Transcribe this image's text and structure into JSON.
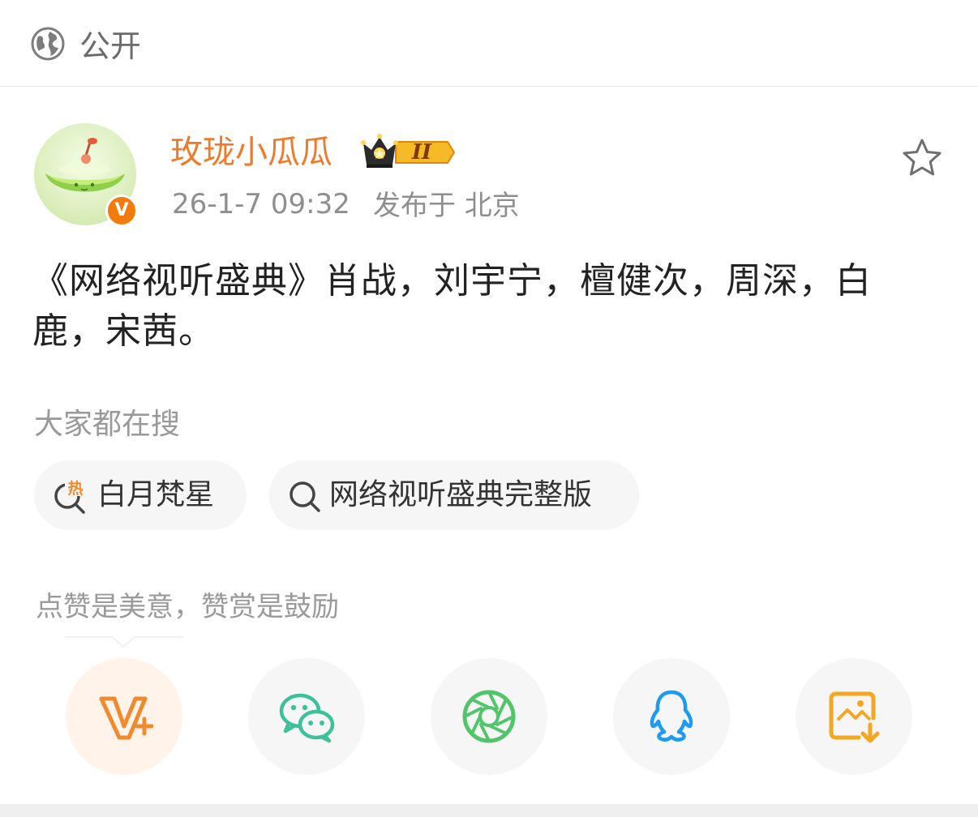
{
  "visibility": {
    "label": "公开",
    "icon": "globe-icon"
  },
  "author": {
    "name": "玫珑小瓜瓜",
    "verified": true,
    "verified_badge_text": "V",
    "member_level": "II",
    "name_color": "#ef7b2a"
  },
  "post": {
    "time": "26-1-7 09:32",
    "location": "发布于 北京",
    "text": "《网络视听盛典》肖战，刘宇宁，檀健次，周深，白鹿，宋茜。"
  },
  "hot_search": {
    "heading": "大家都在搜",
    "items": [
      {
        "label": "白月梵星",
        "icon": "hot-search-icon",
        "hot_label": "热"
      },
      {
        "label": "网络视听盛典完整版",
        "icon": "search-icon"
      }
    ]
  },
  "reward": {
    "tip": "点赞是美意，赞赏是鼓励"
  },
  "share": [
    {
      "name": "reward",
      "icon": "v-plus-icon",
      "color": "#f08a2e"
    },
    {
      "name": "wechat",
      "icon": "wechat-icon",
      "color": "#3cc19b"
    },
    {
      "name": "moments",
      "icon": "moments-icon",
      "color": "#52c46a"
    },
    {
      "name": "qq",
      "icon": "qq-icon",
      "color": "#1e9bf0"
    },
    {
      "name": "save-image",
      "icon": "save-image-icon",
      "color": "#f5a623"
    }
  ]
}
